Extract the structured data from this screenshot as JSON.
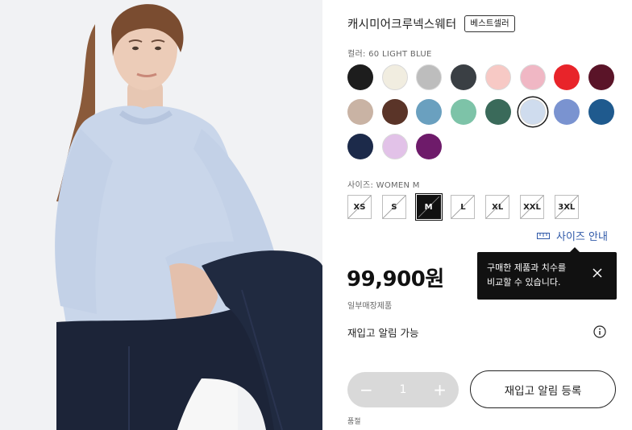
{
  "product": {
    "title": "캐시미어크루넥스웨터",
    "badge": "베스트셀러",
    "color_label": "컬러: 60 LIGHT BLUE",
    "size_label": "사이즈: WOMEN M",
    "price": "99,900원",
    "store_only": "일부매장제품",
    "restock_text": "재입고 알림 가능",
    "sold_out": "품절"
  },
  "colors": [
    {
      "name": "black",
      "hex": "#1d1d1d"
    },
    {
      "name": "off-white",
      "hex": "#f1ede0"
    },
    {
      "name": "light-gray",
      "hex": "#bdbdbd"
    },
    {
      "name": "dark-gray",
      "hex": "#3a3f44"
    },
    {
      "name": "pink",
      "hex": "#f7c9c5"
    },
    {
      "name": "light-pink",
      "hex": "#f0b7c4"
    },
    {
      "name": "red",
      "hex": "#e8242a"
    },
    {
      "name": "wine",
      "hex": "#5a1428"
    },
    {
      "name": "beige",
      "hex": "#c9b3a4"
    },
    {
      "name": "brown",
      "hex": "#5a3428"
    },
    {
      "name": "blue-gray",
      "hex": "#6aa0bf"
    },
    {
      "name": "mint",
      "hex": "#7dc3a8"
    },
    {
      "name": "dark-green",
      "hex": "#3a6a5a"
    },
    {
      "name": "light-blue",
      "hex": "#cfdcee",
      "selected": true
    },
    {
      "name": "periwinkle",
      "hex": "#7a93d0"
    },
    {
      "name": "navy-blue",
      "hex": "#1f5a8e"
    },
    {
      "name": "navy",
      "hex": "#1c2a4a"
    },
    {
      "name": "lavender",
      "hex": "#e2c2e8"
    },
    {
      "name": "purple",
      "hex": "#6e1b6a"
    }
  ],
  "sizes": [
    {
      "label": "XS",
      "unavailable": true
    },
    {
      "label": "S",
      "unavailable": true
    },
    {
      "label": "M",
      "unavailable": true,
      "selected": true
    },
    {
      "label": "L",
      "unavailable": true
    },
    {
      "label": "XL",
      "unavailable": true
    },
    {
      "label": "XXL",
      "unavailable": true
    },
    {
      "label": "3XL",
      "unavailable": true
    }
  ],
  "size_guide": {
    "label": "사이즈 안내"
  },
  "tooltip": {
    "line1": "구매한 제품과 치수를",
    "line2": "비교할 수 있습니다."
  },
  "stepper": {
    "minus": "−",
    "value": "1",
    "plus": "+"
  },
  "notify_button": {
    "label": "재입고 알림 등록"
  }
}
